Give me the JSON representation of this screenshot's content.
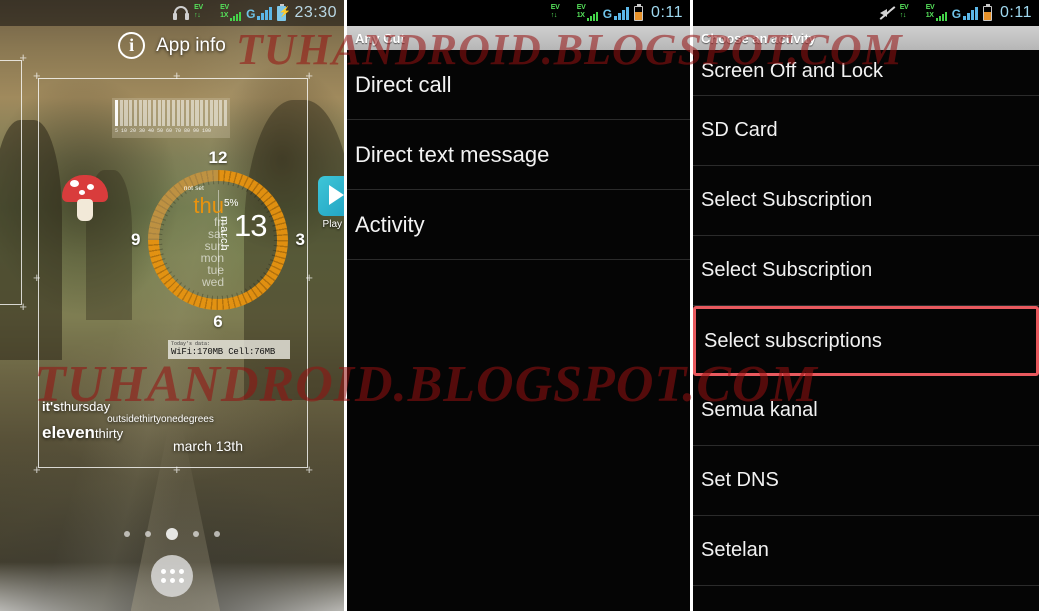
{
  "watermark": {
    "text": "TUHANDROID.BLOGSPOT.COM",
    "color": "#961010"
  },
  "panel1": {
    "name": "homescreen",
    "statusbar": {
      "time": "23:30",
      "icons": [
        "headset-icon",
        "ev-signal-icon",
        "ev-1x-signal-icon",
        "g-signal-icon",
        "battery-charging-icon"
      ]
    },
    "app_info": {
      "label": "App info",
      "icon": "info-icon"
    },
    "barcode_widget": {
      "numbers": "5  10 20 30 40 50 60 70 80 90 100"
    },
    "clock_widget": {
      "hours": [
        "12",
        "3",
        "6",
        "9"
      ],
      "day_active": "thu",
      "days": [
        "fri",
        "sat",
        "sun",
        "mon",
        "tue",
        "wed"
      ],
      "not_set": "not set",
      "battery_percent": "5%",
      "month": "march",
      "day_number": "13"
    },
    "data_widget": {
      "title": "Today's data:",
      "value": "WiFi:170MB Cell:76MB"
    },
    "poem": {
      "line1_bold": "it's",
      "line1_rest": "thursday",
      "line2": "outsidethirtyonedegrees",
      "line3_bold": "eleven",
      "line3_rest": "thirty",
      "line4": "march 13th"
    },
    "shortcut": {
      "label": "Play",
      "icon": "play-store-icon"
    },
    "pager": {
      "pages": 5,
      "active_index": 2
    },
    "app_drawer": {
      "name": "app-drawer-button"
    }
  },
  "panel2": {
    "name": "any-cut-dialog",
    "statusbar": {
      "time": "0:11",
      "icons": [
        "ev-signal-icon",
        "ev-1x-signal-icon",
        "g-signal-icon",
        "battery-icon"
      ]
    },
    "title": "Any Cut",
    "items": [
      {
        "label": "Direct call"
      },
      {
        "label": "Direct text message"
      },
      {
        "label": "Activity"
      }
    ]
  },
  "panel3": {
    "name": "choose-an-activity-dialog",
    "statusbar": {
      "time": "0:11",
      "icons": [
        "mute-icon",
        "ev-signal-icon",
        "ev-1x-signal-icon",
        "g-signal-icon",
        "battery-icon"
      ]
    },
    "title": "Choose an activity",
    "highlight_color": "#e8595e",
    "items": [
      {
        "label": "Screen Off and Lock",
        "selected": false
      },
      {
        "label": "SD Card",
        "selected": false
      },
      {
        "label": "Select Subscription",
        "selected": false
      },
      {
        "label": "Select Subscription",
        "selected": false
      },
      {
        "label": "Select subscriptions",
        "selected": true
      },
      {
        "label": "Semua kanal",
        "selected": false
      },
      {
        "label": "Set DNS",
        "selected": false
      },
      {
        "label": "Setelan",
        "selected": false
      }
    ]
  }
}
